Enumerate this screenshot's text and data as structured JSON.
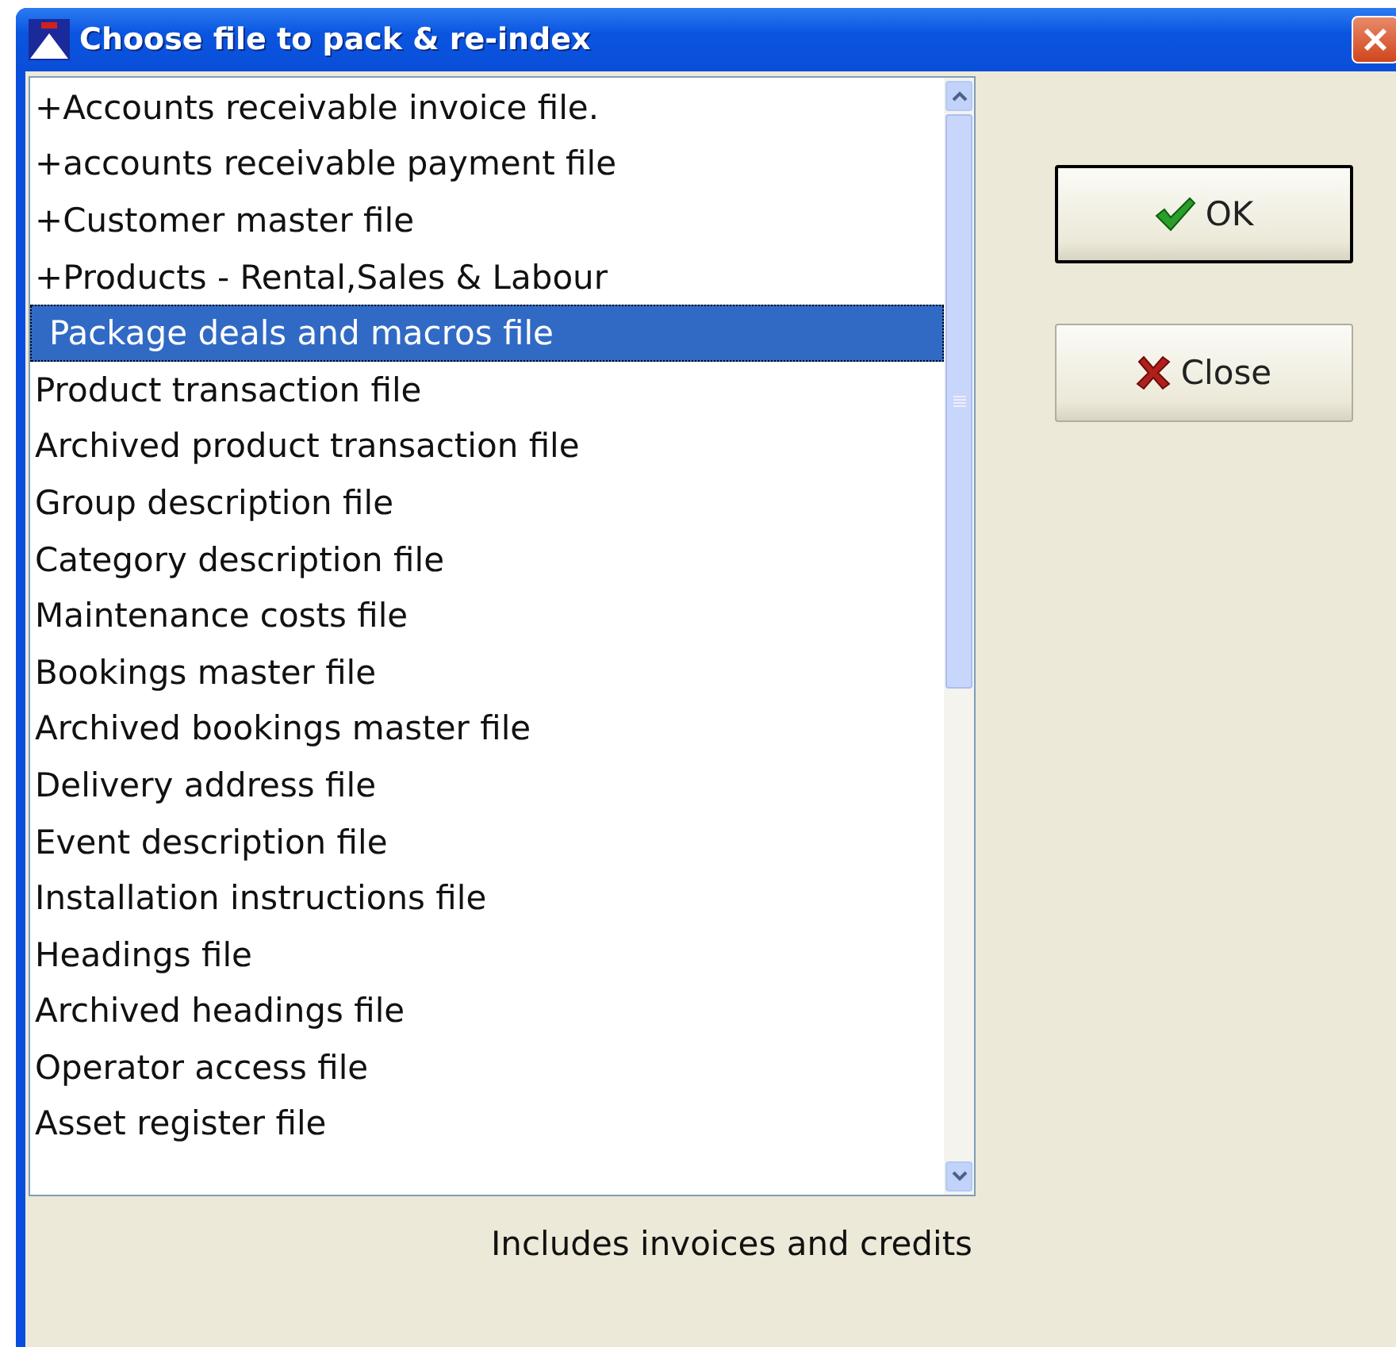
{
  "window": {
    "title": "Choose file to pack & re-index"
  },
  "files": [
    {
      "label": "+Accounts receivable invoice file.",
      "selected": false
    },
    {
      "label": "+accounts receivable payment file",
      "selected": false
    },
    {
      "label": "+Customer master file",
      "selected": false
    },
    {
      "label": "+Products - Rental,Sales & Labour",
      "selected": false
    },
    {
      "label": "Package deals and macros file",
      "selected": true
    },
    {
      "label": "Product transaction file",
      "selected": false
    },
    {
      "label": "Archived product transaction file",
      "selected": false
    },
    {
      "label": "Group description file",
      "selected": false
    },
    {
      "label": "Category description file",
      "selected": false
    },
    {
      "label": "Maintenance costs file",
      "selected": false
    },
    {
      "label": "Bookings master file",
      "selected": false
    },
    {
      "label": "Archived bookings master file",
      "selected": false
    },
    {
      "label": "Delivery address file",
      "selected": false
    },
    {
      "label": "Event description file",
      "selected": false
    },
    {
      "label": "Installation instructions file",
      "selected": false
    },
    {
      "label": "Headings file",
      "selected": false
    },
    {
      "label": "Archived headings file",
      "selected": false
    },
    {
      "label": "Operator access file",
      "selected": false
    },
    {
      "label": "Asset register file",
      "selected": false
    }
  ],
  "buttons": [
    {
      "kind": "ok",
      "label": "OK",
      "default": true
    },
    {
      "kind": "close",
      "label": "Close",
      "default": false
    }
  ],
  "description": "Includes invoices and credits"
}
